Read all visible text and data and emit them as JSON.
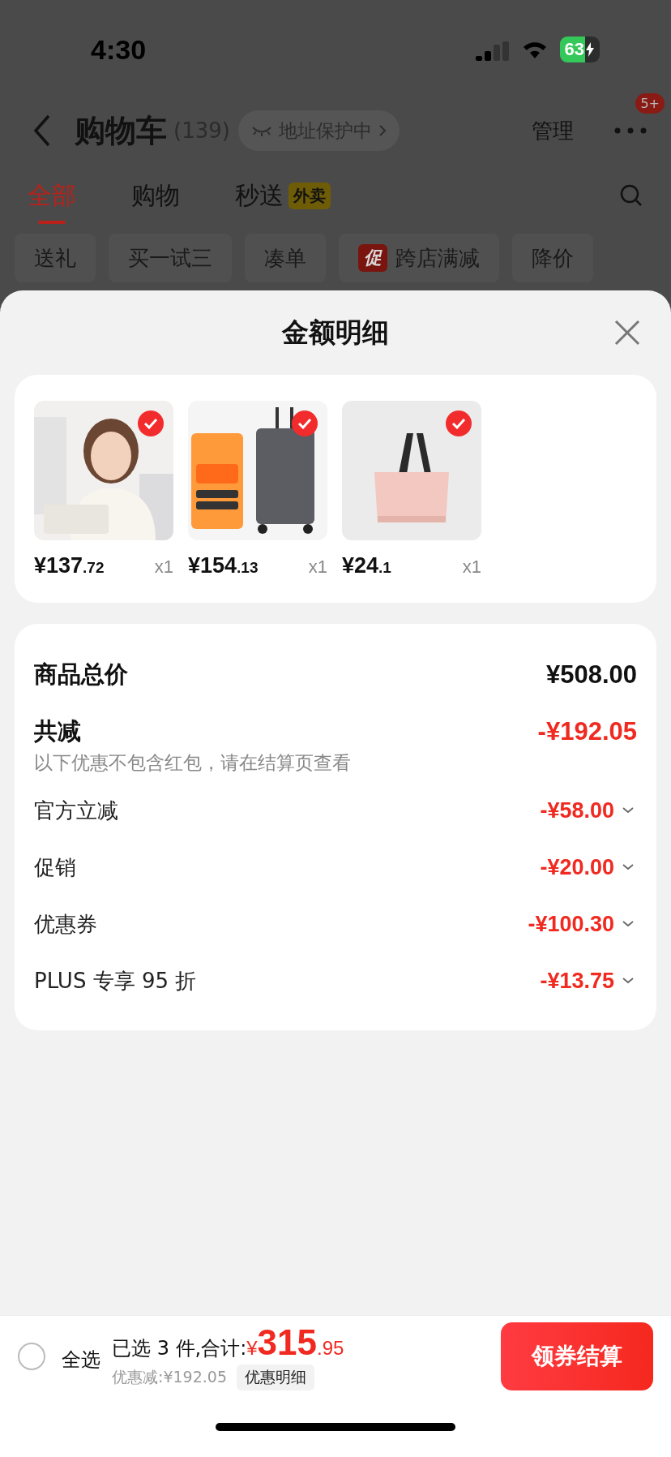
{
  "status_bar": {
    "time": "4:30",
    "battery": "63"
  },
  "header": {
    "title": "购物车",
    "count": "(139)",
    "address_pill": "地址保护中",
    "manage": "管理",
    "badge": "5+"
  },
  "tabs": [
    {
      "label": "全部",
      "selected": true
    },
    {
      "label": "购物",
      "selected": false
    },
    {
      "label": "秒送",
      "selected": false,
      "tag": "外卖"
    }
  ],
  "chips": [
    {
      "label": "送礼"
    },
    {
      "label": "买一试三"
    },
    {
      "label": "凑单"
    },
    {
      "label": "跨店满减",
      "tag": "促"
    },
    {
      "label": "降价"
    }
  ],
  "sheet": {
    "title": "金额明细",
    "products": [
      {
        "kind": "person",
        "price": "¥137",
        "decimal": ".72",
        "qty": "x1",
        "checked": true
      },
      {
        "kind": "suitcase",
        "price": "¥154",
        "decimal": ".13",
        "qty": "x1",
        "checked": true
      },
      {
        "kind": "bag",
        "price": "¥24",
        "decimal": ".1",
        "qty": "x1",
        "checked": true
      }
    ],
    "total": {
      "label": "商品总价",
      "value": "¥508.00"
    },
    "reduction": {
      "label": "共减",
      "value": "-¥192.05",
      "note": "以下优惠不包含红包，请在结算页查看"
    },
    "discounts": [
      {
        "label": "官方立减",
        "value": "-¥58.00"
      },
      {
        "label": "促销",
        "value": "-¥20.00"
      },
      {
        "label": "优惠券",
        "value": "-¥100.30"
      },
      {
        "label": "PLUS 专享 95 折",
        "value": "-¥13.75"
      }
    ]
  },
  "bottom_bar": {
    "select_all": {
      "label": "全选",
      "checked": false
    },
    "selected_text": "已选 3 件,合计:",
    "currency": "¥",
    "amount": "315",
    "decimal": ".95",
    "saving": "优惠减:¥192.05",
    "detail_button": "优惠明细",
    "checkout": "领券结算"
  }
}
